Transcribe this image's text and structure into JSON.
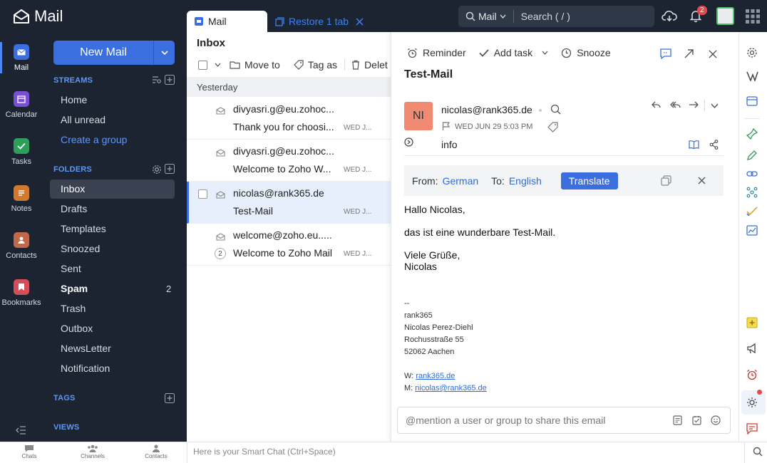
{
  "app": {
    "brand": "Mail",
    "tab_mail": "Mail",
    "restore_tab": "Restore 1 tab",
    "search_scope": "Mail",
    "search_placeholder": "Search ( / )",
    "notification_count": "2"
  },
  "apps": [
    {
      "label": "Mail",
      "icon": "mail-icon",
      "color": "#3b6fe0"
    },
    {
      "label": "Calendar",
      "icon": "calendar-icon",
      "color": "#7a4fd6"
    },
    {
      "label": "Tasks",
      "icon": "tasks-icon",
      "color": "#2e9e5b"
    },
    {
      "label": "Notes",
      "icon": "notes-icon",
      "color": "#d0792f"
    },
    {
      "label": "Contacts",
      "icon": "contacts-icon",
      "color": "#c0684a"
    },
    {
      "label": "Bookmarks",
      "icon": "bookmarks-icon",
      "color": "#d64d5a"
    }
  ],
  "sidebar": {
    "new_mail": "New Mail",
    "streams_header": "STREAMS",
    "streams": [
      "Home",
      "All unread",
      "Create a group"
    ],
    "folders_header": "FOLDERS",
    "folders": [
      "Inbox",
      "Drafts",
      "Templates",
      "Snoozed",
      "Sent",
      "Spam",
      "Trash",
      "Outbox",
      "NewsLetter",
      "Notification"
    ],
    "spam_count": "2",
    "tags_header": "TAGS",
    "views_header": "VIEWS"
  },
  "list": {
    "title": "Inbox",
    "toolbar": {
      "move_to": "Move to",
      "tag_as": "Tag as",
      "delete": "Delet"
    },
    "group_label": "Yesterday",
    "messages": [
      {
        "from": "divyasri.g@eu.zohoc...",
        "subject": "Thank you for choosi...",
        "date": "WED J..."
      },
      {
        "from": "divyasri.g@eu.zohoc...",
        "subject": "Welcome to Zoho W...",
        "date": "WED J..."
      },
      {
        "from": "nicolas@rank365.de",
        "subject": "Test-Mail",
        "date": "WED J..."
      },
      {
        "from": "welcome@zoho.eu.....",
        "subject": "Welcome to Zoho Mail",
        "date": "WED J...",
        "thread_count": "2"
      }
    ]
  },
  "reader": {
    "toolbar": {
      "reminder": "Reminder",
      "add_task": "Add task",
      "snooze": "Snooze"
    },
    "subject": "Test-Mail",
    "avatar_initials": "NI",
    "sender": "nicolas@rank365.de",
    "date": "WED JUN 29 5:03 PM",
    "recipient": "info",
    "translate": {
      "from_label": "From:",
      "from_lang": "German",
      "to_label": "To:",
      "to_lang": "English",
      "button": "Translate"
    },
    "body": {
      "greeting": "Hallo Nicolas,",
      "line1": "das ist eine wunderbare Test-Mail.",
      "closing1": "Viele Grüße,",
      "closing2": "Nicolas"
    },
    "signature": {
      "dash": "--",
      "company": "rank365",
      "name": "Nicolas Perez-Diehl",
      "street": "Rochusstraße 55",
      "city": "52062 Aachen",
      "web_label": "W:",
      "web": "rank365.de",
      "mail_label": "M:",
      "mail": "nicolas@rank365.de"
    },
    "comment_placeholder": "@mention a user or group to share this email"
  },
  "bottom": {
    "chats": "Chats",
    "channels": "Channels",
    "contacts": "Contacts",
    "smart_chat": "Here is your Smart Chat (Ctrl+Space)"
  }
}
